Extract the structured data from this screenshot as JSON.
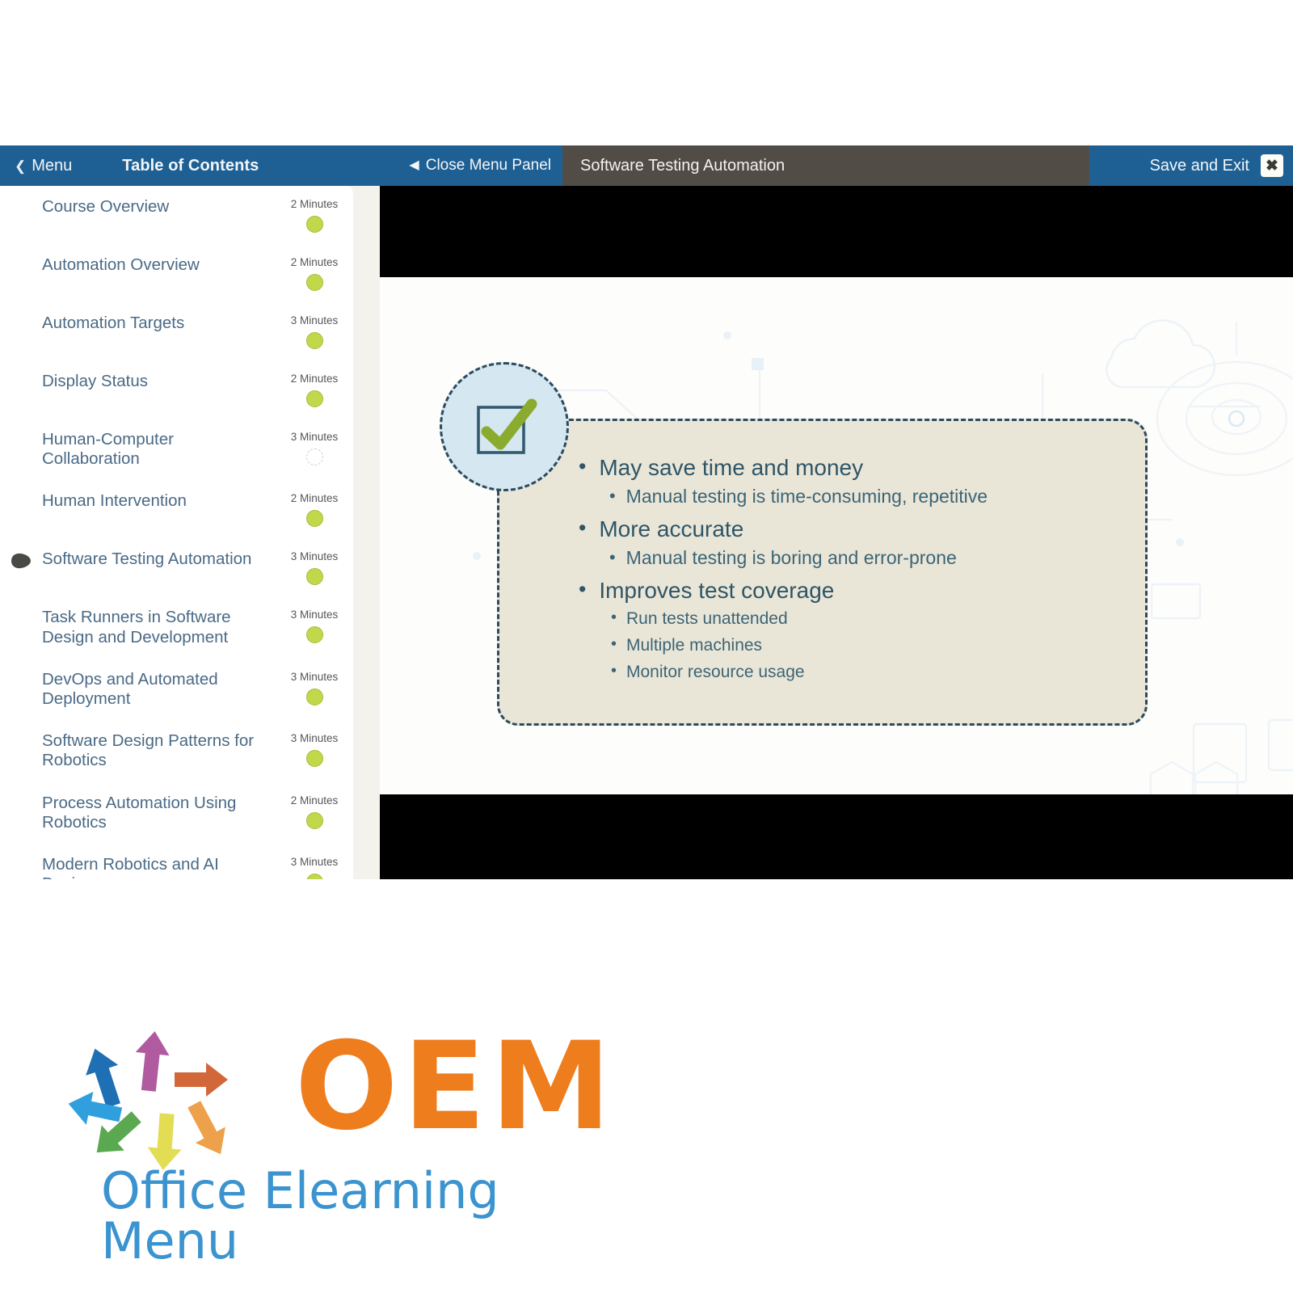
{
  "colors": {
    "brand_blue": "#1f6094",
    "slide_title_bar": "#514d46",
    "accent_orange": "#ee7d1e",
    "accent_lightblue": "#3b94cf",
    "dot_green": "#c2d84b",
    "callout_bg": "#e9e6d8",
    "callout_border": "#2e4a5c",
    "check_green": "#8aab2e"
  },
  "topbar": {
    "menu_label": "Menu",
    "menu_chevron": "chevron-left-icon",
    "toc_title": "Table of Contents",
    "close_panel_label": "Close Menu Panel",
    "close_panel_chevron": "triangle-left-icon",
    "slide_title": "Software Testing Automation",
    "save_exit_label": "Save and Exit",
    "close_label": "✖"
  },
  "sidebar": {
    "items": [
      {
        "label": "Course Overview",
        "duration": "2 Minutes",
        "status": "complete",
        "current": false
      },
      {
        "label": "Automation Overview",
        "duration": "2 Minutes",
        "status": "complete",
        "current": false
      },
      {
        "label": "Automation Targets",
        "duration": "3 Minutes",
        "status": "complete",
        "current": false
      },
      {
        "label": "Display Status",
        "duration": "2 Minutes",
        "status": "complete",
        "current": false
      },
      {
        "label": "Human-Computer Collaboration",
        "duration": "3 Minutes",
        "status": "incomplete",
        "current": false
      },
      {
        "label": "Human Intervention",
        "duration": "2 Minutes",
        "status": "complete",
        "current": false
      },
      {
        "label": "Software Testing Automation",
        "duration": "3 Minutes",
        "status": "complete",
        "current": true
      },
      {
        "label": "Task Runners in Software Design and Development",
        "duration": "3 Minutes",
        "status": "complete",
        "current": false
      },
      {
        "label": "DevOps and Automated Deployment",
        "duration": "3 Minutes",
        "status": "complete",
        "current": false
      },
      {
        "label": "Software Design Patterns for Robotics",
        "duration": "3 Minutes",
        "status": "complete",
        "current": false
      },
      {
        "label": "Process Automation Using Robotics",
        "duration": "2 Minutes",
        "status": "complete",
        "current": false
      },
      {
        "label": "Modern Robotics and AI Designs",
        "duration": "3 Minutes",
        "status": "complete",
        "current": false
      }
    ]
  },
  "slide": {
    "icon": "checkmark-in-box-icon",
    "bullets": [
      {
        "level": 1,
        "text": "May save time and money"
      },
      {
        "level": 2,
        "text": "Manual testing is time-consuming, repetitive"
      },
      {
        "level": 1,
        "text": "More accurate"
      },
      {
        "level": 2,
        "text": "Manual testing is boring and error-prone"
      },
      {
        "level": 1,
        "text": "Improves test coverage"
      },
      {
        "level": 3,
        "text": "Run tests unattended"
      },
      {
        "level": 3,
        "text": "Multiple machines"
      },
      {
        "level": 3,
        "text": "Monitor resource usage"
      }
    ]
  },
  "logo": {
    "wordmark": "OEM",
    "tagline": "Office Elearning Menu",
    "arrow_colors": [
      "#1f6fb4",
      "#b05aa0",
      "#d2673a",
      "#eda14a",
      "#e2dd52",
      "#5aa84f",
      "#2fa0dd"
    ]
  }
}
